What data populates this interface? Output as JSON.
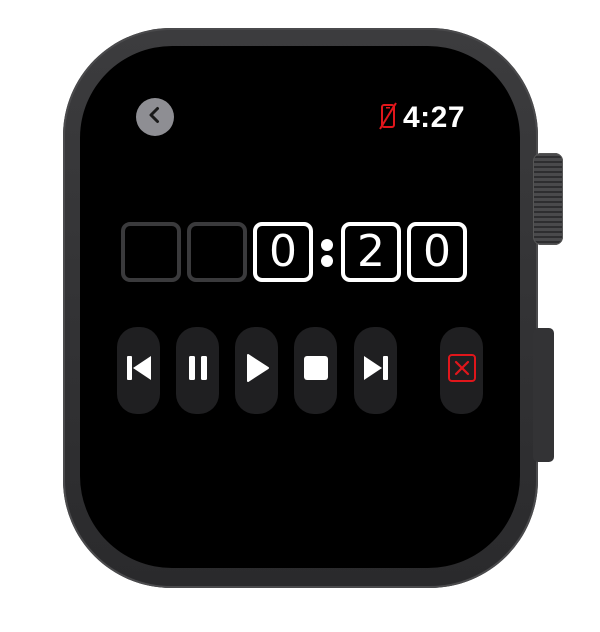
{
  "watch": {
    "clock": "4:27",
    "icons": {
      "back": "chevron-left-icon",
      "status": "no-phone-connection-icon"
    },
    "colors": {
      "accent_red": "#e0161b",
      "button_bg": "#1f1f21",
      "back_bg": "#8e8e93"
    }
  },
  "timer": {
    "digits": [
      "",
      "",
      "0",
      "2",
      "0"
    ],
    "active": [
      false,
      false,
      true,
      true,
      true
    ]
  },
  "controls": [
    {
      "name": "skip-back-button",
      "icon": "skip-back-icon"
    },
    {
      "name": "pause-button",
      "icon": "pause-icon"
    },
    {
      "name": "play-button",
      "icon": "play-icon"
    },
    {
      "name": "stop-button",
      "icon": "stop-icon"
    },
    {
      "name": "skip-forward-button",
      "icon": "skip-forward-icon"
    },
    {
      "name": "cancel-button",
      "icon": "cancel-x-icon"
    }
  ]
}
